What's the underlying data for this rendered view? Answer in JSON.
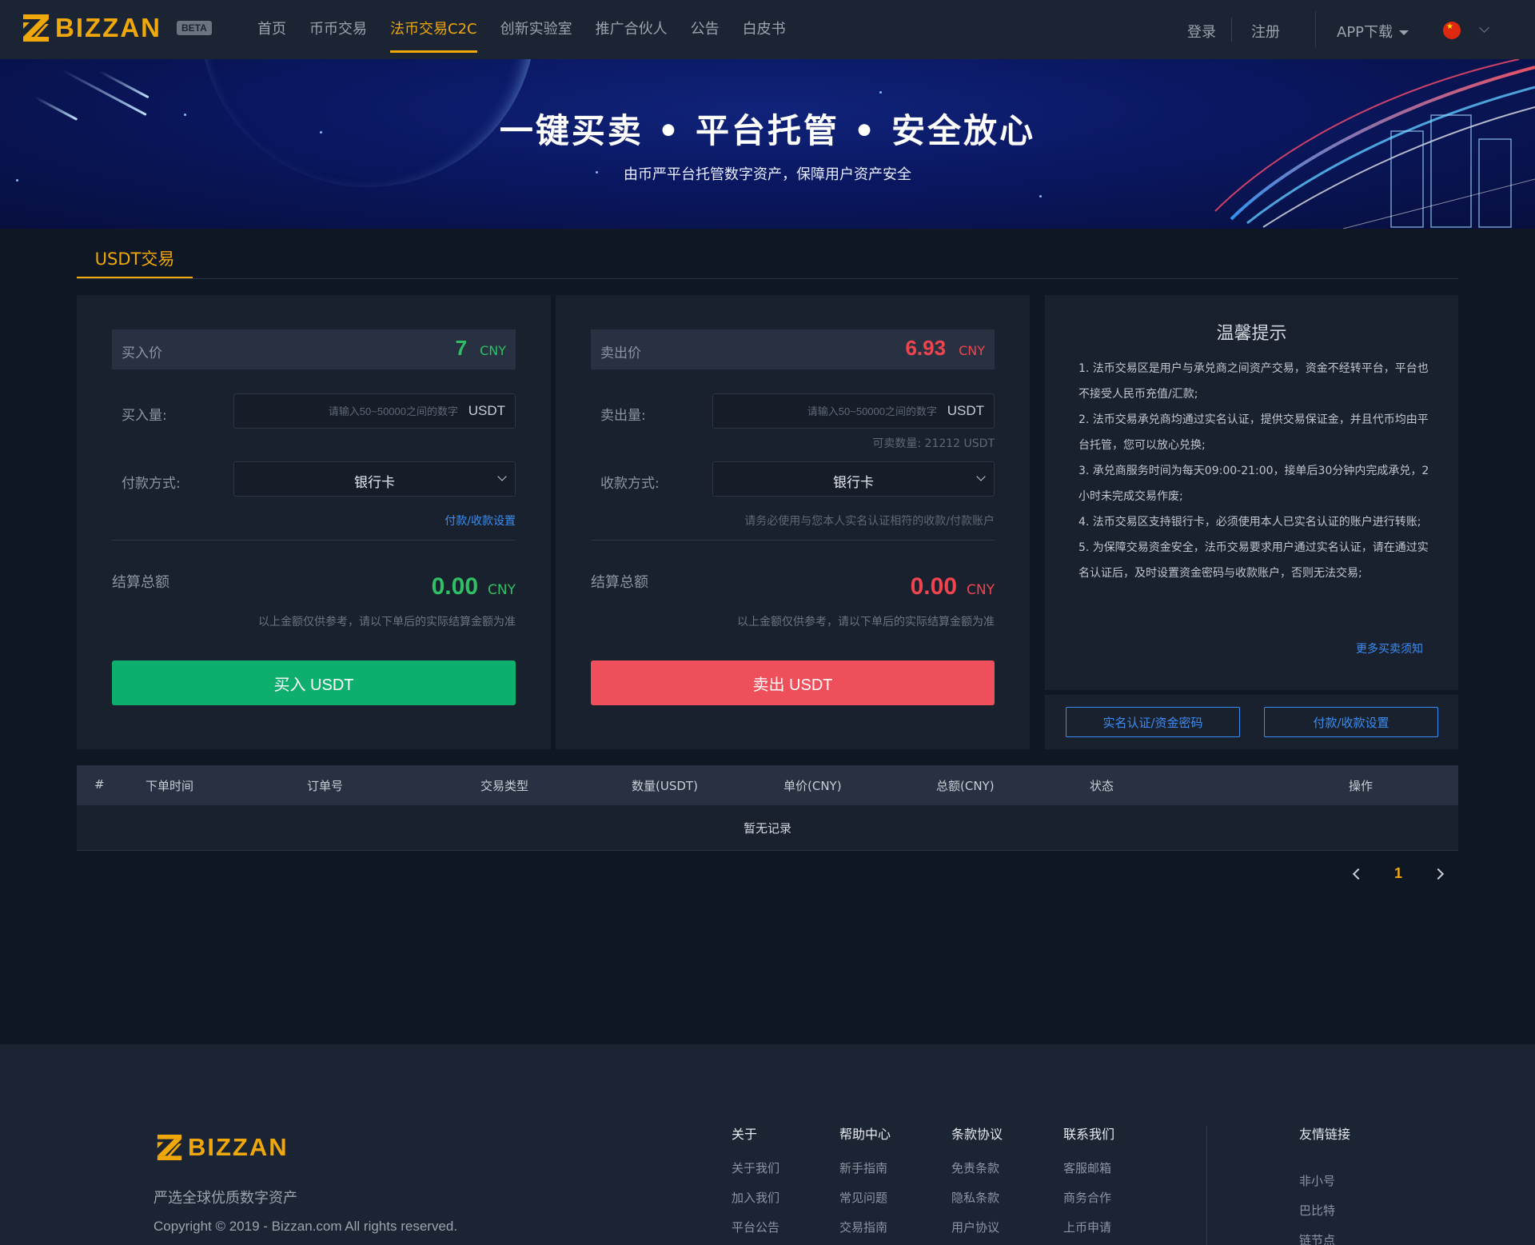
{
  "header": {
    "logo_text": "BIZZAN",
    "beta": "BETA",
    "nav": [
      "首页",
      "币币交易",
      "法币交易C2C",
      "创新实验室",
      "推广合伙人",
      "公告",
      "白皮书"
    ],
    "active_nav": "法币交易C2C",
    "login": "登录",
    "register": "注册",
    "app_download": "APP下载",
    "language_icon": "china-flag-icon"
  },
  "banner": {
    "title": "一键买卖 • 平台托管 • 安全放心",
    "subtitle": "由币严平台托管数字资产，保障用户资产安全"
  },
  "trade": {
    "tab": "USDT交易",
    "buy": {
      "price_label": "买入价",
      "price": "7",
      "price_unit": "CNY",
      "amount_label": "买入量:",
      "amount_placeholder": "请输入50~50000之间的数字",
      "amount_unit": "USDT",
      "method_label": "付款方式:",
      "method_value": "银行卡",
      "settings_link": "付款/收款设置",
      "total_label": "结算总额",
      "total": "0.00",
      "total_unit": "CNY",
      "note": "以上金额仅供参考，请以下单后的实际结算金额为准",
      "button": "买入 USDT"
    },
    "sell": {
      "price_label": "卖出价",
      "price": "6.93",
      "price_unit": "CNY",
      "amount_label": "卖出量:",
      "amount_placeholder": "请输入50~50000之间的数字",
      "amount_unit": "USDT",
      "available": "可卖数量:  21212  USDT",
      "method_label": "收款方式:",
      "method_value": "银行卡",
      "method_hint": "请务必使用与您本人实名认证相符的收款/付款账户",
      "total_label": "结算总额",
      "total": "0.00",
      "total_unit": "CNY",
      "note": "以上金额仅供参考，请以下单后的实际结算金额为准",
      "button": "卖出 USDT"
    },
    "tips": {
      "title": "温馨提示",
      "items": [
        "1. 法币交易区是用户与承兑商之间资产交易，资金不经转平台，平台也不接受人民币充值/汇款;",
        "2. 法币交易承兑商均通过实名认证，提供交易保证金，并且代币均由平台托管，您可以放心兑换;",
        "3. 承兑商服务时间为每天09:00-21:00，接单后30分钟内完成承兑，2小时未完成交易作废;",
        "4. 法币交易区支持银行卡，必须使用本人已实名认证的账户进行转账;",
        "5. 为保障交易资金安全，法币交易要求用户通过实名认证，请在通过实名认证后，及时设置资金密码与收款账户，否则无法交易;"
      ],
      "more": "更多买卖须知",
      "btn_realname": "实名认证/资金密码",
      "btn_payment": "付款/收款设置"
    }
  },
  "orders": {
    "columns": [
      "#",
      "下单时间",
      "订单号",
      "交易类型",
      "数量(USDT)",
      "单价(CNY)",
      "总额(CNY)",
      "状态",
      "操作"
    ],
    "empty": "暂无记录",
    "page": "1"
  },
  "footer": {
    "logo_text": "BIZZAN",
    "slogan": "严选全球优质数字资产",
    "copyright": "Copyright © 2019 - Bizzan.com All rights reserved.",
    "columns": [
      {
        "title": "关于",
        "links": [
          "关于我们",
          "加入我们",
          "平台公告"
        ]
      },
      {
        "title": "帮助中心",
        "links": [
          "新手指南",
          "常见问题",
          "交易指南"
        ]
      },
      {
        "title": "条款协议",
        "links": [
          "免责条款",
          "隐私条款",
          "用户协议"
        ]
      },
      {
        "title": "联系我们",
        "links": [
          "客服邮箱",
          "商务合作",
          "上币申请"
        ]
      },
      {
        "title": "友情链接",
        "links": [
          "非小号",
          "巴比特",
          "链节点"
        ]
      }
    ]
  },
  "colors": {
    "accent": "#f0a70a",
    "buy": "#0eaf6e",
    "sell": "#ef4f5a",
    "link": "#3b8df3",
    "background": "#0f1725"
  }
}
